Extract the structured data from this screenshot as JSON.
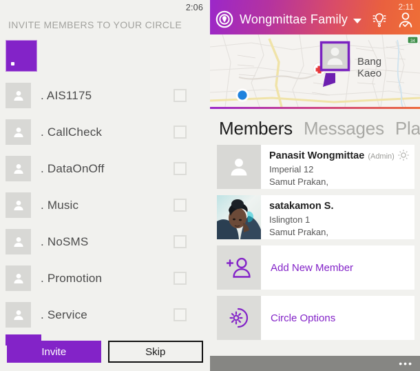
{
  "left_panel": {
    "status_time": "2:06",
    "title": "INVITE MEMBERS TO YOUR CIRCLE",
    "contacts": [
      {
        "name": ". AIS1175",
        "avatar_icon": "person-icon",
        "checked": false
      },
      {
        "name": ". CallCheck",
        "avatar_icon": "person-icon",
        "checked": false
      },
      {
        "name": ". DataOnOff",
        "avatar_icon": "person-icon",
        "checked": false
      },
      {
        "name": ". Music",
        "avatar_icon": "person-icon",
        "checked": false
      },
      {
        "name": ". NoSMS",
        "avatar_icon": "person-icon",
        "checked": false
      },
      {
        "name": ". Promotion",
        "avatar_icon": "person-icon",
        "checked": false
      },
      {
        "name": ". Service",
        "avatar_icon": "person-icon",
        "checked": false
      }
    ],
    "invite_label": "Invite",
    "skip_label": "Skip",
    "accent_color": "#8323c8",
    "background_color": "#f1f1ee"
  },
  "right_panel": {
    "status_time": "2:11",
    "logo_icon": "circle-pin-logo-icon",
    "circle_title": "Wongmittae Family",
    "caret_icon": "chevron-down-icon",
    "alert_icon": "panic-alert-icon",
    "profile_icon": "person-check-icon",
    "header_gradient_from": "#9b27c9",
    "header_gradient_to": "#ef6f37",
    "map": {
      "place_label_line1": "Bang",
      "place_label_line2": "Kaeo",
      "pin_icon": "member-map-pin-icon",
      "hospital_icon": "hospital-cross-icon",
      "self_location_icon": "blue-location-dot-icon",
      "road_shield_icon": "road-shield-icon"
    },
    "tabs": [
      {
        "label": "Members",
        "active": true
      },
      {
        "label": "Messages",
        "active": false
      },
      {
        "label": "Pla",
        "active": false
      }
    ],
    "members": [
      {
        "name": "Panasit Wongmittae",
        "role": "(Admin)",
        "address_line1": "Imperial 12",
        "address_line2": "Samut Prakan,",
        "avatar_type": "placeholder",
        "gear_icon": "gear-icon"
      },
      {
        "name": "satakamon S.",
        "role": "",
        "address_line1": "Islington 1",
        "address_line2": "Samut Prakan,",
        "avatar_type": "photo",
        "gear_icon": ""
      }
    ],
    "actions": [
      {
        "label": "Add New Member",
        "icon": "add-person-icon"
      },
      {
        "label": "Circle Options",
        "icon": "gear-circle-icon"
      }
    ],
    "more_label": "•••",
    "accent_color": "#8323c8"
  }
}
